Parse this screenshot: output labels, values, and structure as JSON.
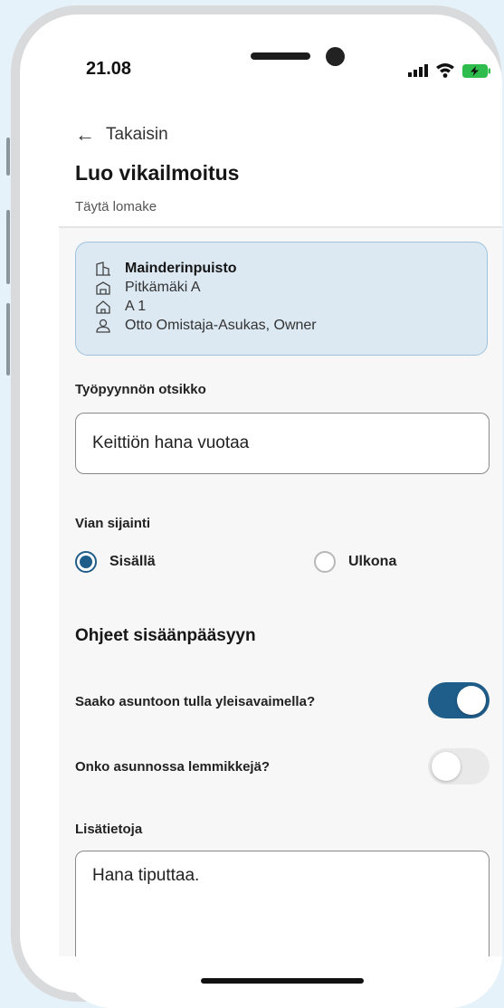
{
  "status_bar": {
    "time": "21.08"
  },
  "header": {
    "back_label": "Takaisin",
    "title": "Luo vikailmoitus",
    "subtitle": "Täytä lomake"
  },
  "info_card": {
    "rows": [
      {
        "icon": "building-icon",
        "text": "Mainderinpuisto"
      },
      {
        "icon": "building-section-icon",
        "text": "Pitkämäki A"
      },
      {
        "icon": "home-icon",
        "text": "A 1"
      },
      {
        "icon": "person-icon",
        "text": "Otto Omistaja-Asukas, Owner"
      }
    ]
  },
  "form": {
    "title_label": "Työpyynnön otsikko",
    "title_value": "Keittiön hana vuotaa",
    "location_label": "Vian sijainti",
    "location_options": [
      {
        "label": "Sisällä",
        "selected": true
      },
      {
        "label": "Ulkona",
        "selected": false
      }
    ],
    "access_section_title": "Ohjeet sisäänpääsyyn",
    "toggles": [
      {
        "label": "Saako asuntoon tulla yleisavaimella?",
        "on": true
      },
      {
        "label": "Onko asunnossa lemmikkejä?",
        "on": false
      }
    ],
    "notes_label": "Lisätietoja",
    "notes_value": "Hana tiputtaa."
  },
  "colors": {
    "accent": "#1f5d8a",
    "card_bg": "#dce9f3",
    "page_bg": "#e6f2f9"
  }
}
